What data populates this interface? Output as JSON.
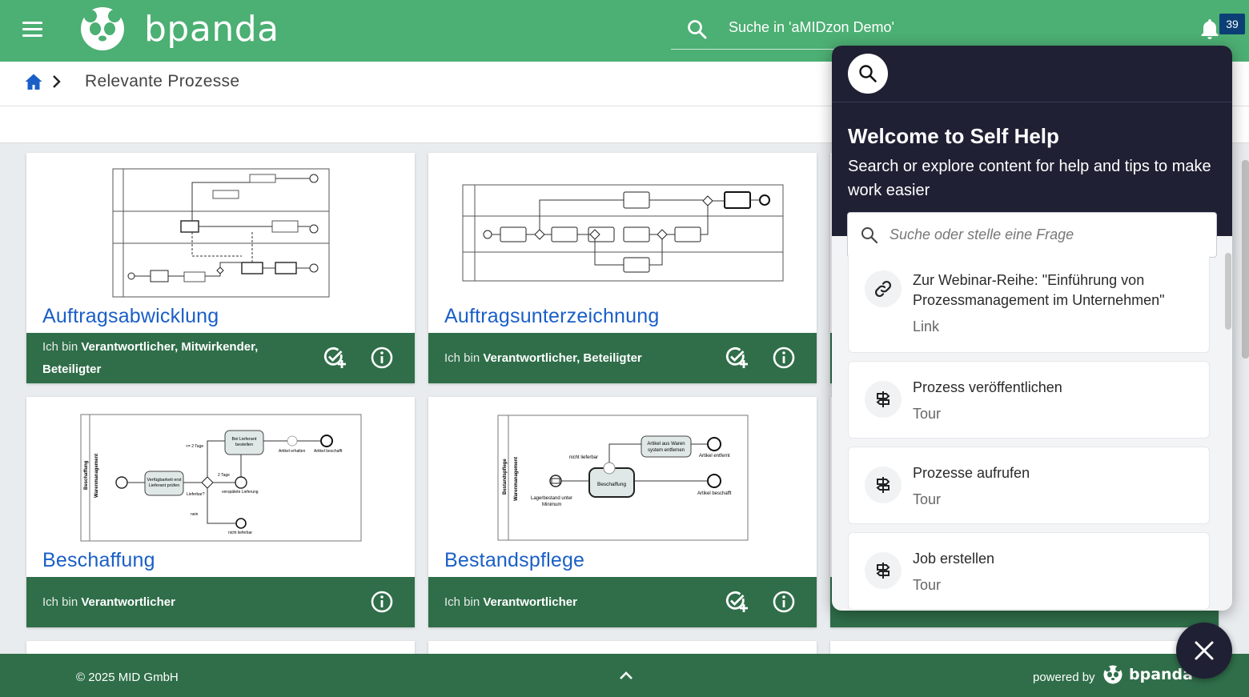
{
  "header": {
    "logo_text": "bpanda",
    "search_label": "Suche in 'aMIDzon Demo'",
    "notification_count": "39"
  },
  "breadcrumb": {
    "title": "Relevante Prozesse"
  },
  "cards": [
    {
      "title": "Auftragsabwicklung",
      "role_prefix": "Ich bin",
      "role_line1": "Verantwortlicher, Mitwirkender,",
      "role_line2": "Beteiligter"
    },
    {
      "title": "Auftragsunterzeichnung",
      "role_prefix": "Ich bin",
      "role_bold": "Verantwortlicher, Beteiligter"
    },
    {
      "title": "Beschaffung",
      "role_prefix": "Ich bin",
      "role_bold": "Verantwortlicher"
    },
    {
      "title": "Bestandspflege",
      "role_prefix": "Ich bin",
      "role_bold": "Verantwortlicher"
    }
  ],
  "diagram_labels": {
    "beschaffung": {
      "lane1": "Beschaffung",
      "lane2": "Warenmanagement",
      "task1": "Verfügbarkeit erst",
      "task1b": "Lieferant prüfen",
      "task2": "Bei Lieferant",
      "task2b": "bestellen",
      "cond1": "<= 2 Tage",
      "cond2": "2 Tage",
      "lieferbar": "Lieferbar?",
      "nein": "nein",
      "spaet": "verspätete Lieferung",
      "nicht": "nicht lieferbar",
      "erhalten": "Artikel erhalten",
      "beschafft": "Artikel beschafft"
    },
    "bestandspflege": {
      "lane1": "Bestandspflege",
      "lane2": "Warenmanagement",
      "task1": "Artikel aus Waren",
      "task1b": "system entfernen",
      "task2": "Beschaffung",
      "nicht": "nicht lieferbar",
      "lager": "Lagerbestand unter",
      "lagerb": "Minimum",
      "entfernt": "Artikel entfernt",
      "beschafft": "Artikel beschafft"
    }
  },
  "footer": {
    "copyright": "© 2025 MID GmbH",
    "powered_by": "powered by",
    "brand": "bpanda"
  },
  "self_help": {
    "title": "Welcome to Self Help",
    "subtitle": "Search or explore content for help and tips to make work easier",
    "search_placeholder": "Suche oder stelle eine Frage",
    "items": [
      {
        "title": "Zur Webinar-Reihe: \"Einführung von Prozessmanagement im Unternehmen\"",
        "kind": "Link",
        "icon": "link-icon"
      },
      {
        "title": "Prozess veröffentlichen",
        "kind": "Tour",
        "icon": "signpost-icon"
      },
      {
        "title": "Prozesse aufrufen",
        "kind": "Tour",
        "icon": "signpost-icon"
      },
      {
        "title": "Job erstellen",
        "kind": "Tour",
        "icon": "signpost-icon"
      }
    ]
  },
  "colors": {
    "header_green": "#4caf73",
    "footer_green": "#2f6e49",
    "title_blue": "#1a5fc7",
    "panel_dark": "#1f2033",
    "badge_blue": "#0b3f75"
  }
}
